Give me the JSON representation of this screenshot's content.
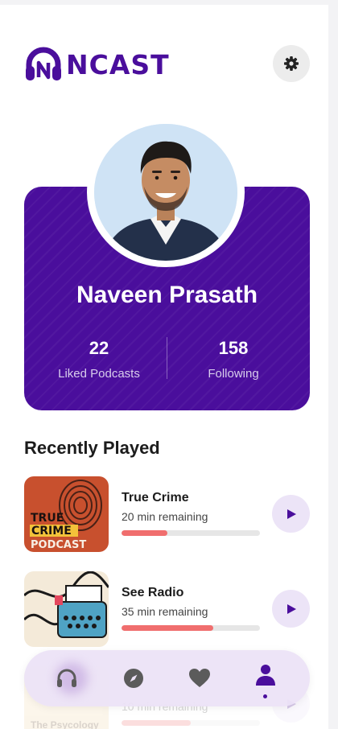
{
  "brand": {
    "name": "NCAST",
    "color": "#4a0e9c",
    "logo_icon": "headphones-icon"
  },
  "header": {
    "settings_icon": "gear-icon"
  },
  "profile": {
    "name": "Naveen Prasath",
    "avatar": "user-photo-avatar",
    "stats": [
      {
        "value": "22",
        "label": "Liked Podcasts"
      },
      {
        "value": "158",
        "label": "Following"
      }
    ]
  },
  "recently_played": {
    "title": "Recently Played",
    "items": [
      {
        "title": "True Crime",
        "remaining": "20 min remaining",
        "progress": 0.33,
        "cover_text": [
          "TRUE",
          "CRIME",
          "PODCAST"
        ],
        "play_icon": "play-icon"
      },
      {
        "title": "See Radio",
        "remaining": "35 min remaining",
        "progress": 0.66,
        "play_icon": "play-icon"
      },
      {
        "title": "",
        "remaining": "10 min remaining",
        "progress": 0.5,
        "cover_text": [
          "The Psycology"
        ],
        "play_icon": "play-icon"
      }
    ]
  },
  "nav": {
    "items": [
      {
        "icon": "headphones-icon",
        "active": false
      },
      {
        "icon": "compass-icon",
        "active": false
      },
      {
        "icon": "heart-icon",
        "active": false
      },
      {
        "icon": "profile-icon",
        "active": true
      }
    ]
  },
  "colors": {
    "accent": "#4a0e9c",
    "progress": "#f06e6e",
    "play_bg": "#ece4f7"
  }
}
